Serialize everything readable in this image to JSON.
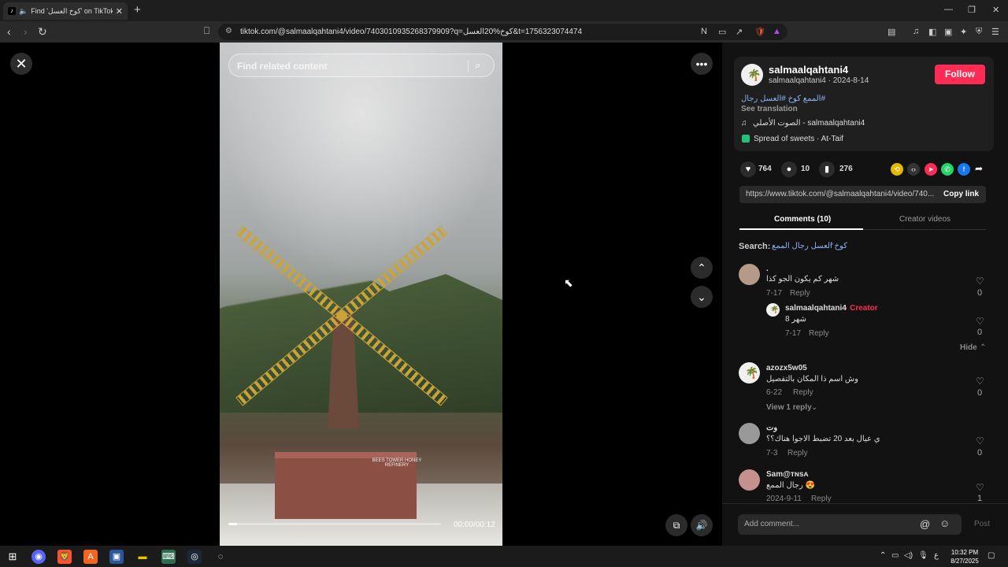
{
  "browser": {
    "tab_title": "Find 'كوخ العسل' on TikTok | T",
    "url": "tiktok.com/@salmaalqahtani4/video/7403010935268379909?q=كوخ%20العسل&t=1756323074474"
  },
  "search": {
    "placeholder": "Find related content"
  },
  "video": {
    "timecode": "00:00/00:12",
    "progress": 0.04,
    "sign_text": "BEES TOWER HONEY REFINERY"
  },
  "author": {
    "username": "salmaalqahtani4",
    "subline": "salmaalqahtani4 · 2024-8-14",
    "follow_label": "Follow",
    "caption_hashtags": "#الممع كوخ #العسل رجال",
    "see_translation": "See translation",
    "sound": "الصوت الأصلي - salmaalqahtani4",
    "location": "Spread of sweets · At-Taif"
  },
  "stats": {
    "likes": "764",
    "comments": "10",
    "saves": "276"
  },
  "link": {
    "url": "https://www.tiktok.com/@salmaalqahtani4/video/740...",
    "copy_label": "Copy link"
  },
  "panel_tabs": {
    "comments": "Comments (10)",
    "creator_videos": "Creator videos"
  },
  "search_label": {
    "prefix": "Search:",
    "query": "كوخ العسل رجال الممع"
  },
  "comments": [
    {
      "user": ".",
      "text": "شهر كم يكون الجو كذا",
      "date": "7-17",
      "reply": "Reply",
      "likes": "0"
    },
    {
      "user": "salmaalqahtani4",
      "creator_tag": "· Creator",
      "text": "شهر 8",
      "date": "7-17",
      "reply": "Reply",
      "likes": "0"
    },
    {
      "user": "azozx5w05",
      "text": "وش اسم ذا المكان بالتفصيل",
      "date": "6-22",
      "reply": "Reply",
      "likes": "0",
      "view_replies": "View 1 reply"
    },
    {
      "user": "وت",
      "text": "ي عيال بعد 20 تضبط الاجوا هناك؟؟",
      "date": "7-3",
      "reply": "Reply",
      "likes": "0"
    },
    {
      "user": "Sam@ᴛɴsᴀ",
      "text": "رجال الممع 😍",
      "date": "2024-9-11",
      "reply": "Reply",
      "likes": "1"
    }
  ],
  "hide_label": "Hide",
  "comment_input": {
    "placeholder": "Add comment...",
    "post_label": "Post"
  },
  "clock": {
    "time": "10:32 PM",
    "date": "8/27/2025"
  },
  "tray_lang": "ع",
  "colors": {
    "accent": "#fe2c55",
    "hashtag": "#8ab4f8",
    "panel_bg": "#121212"
  }
}
